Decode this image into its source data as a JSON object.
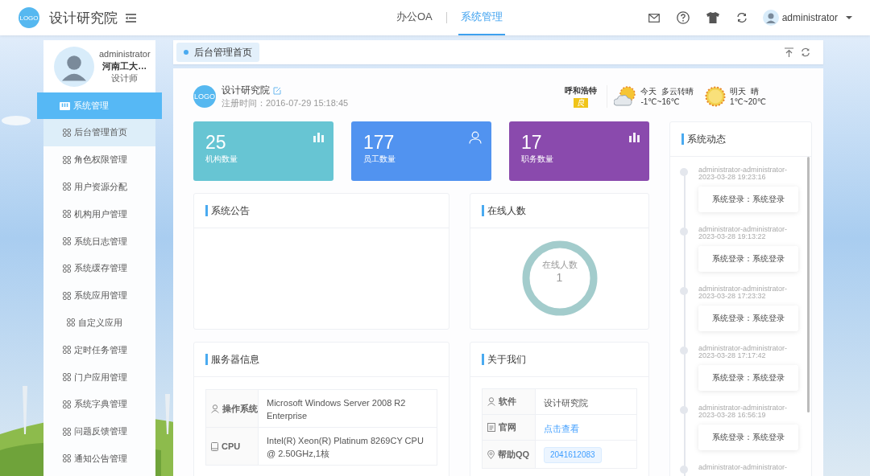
{
  "header": {
    "logo": "LOGO",
    "title": "设计研究院",
    "nav": [
      {
        "label": "办公OA",
        "selected": false
      },
      {
        "label": "系统管理",
        "selected": true
      }
    ],
    "user": "administrator"
  },
  "profile": {
    "name": "administrator",
    "org": "河南工大…",
    "role": "设计师"
  },
  "sidebar": {
    "section": "系统管理",
    "items": [
      {
        "label": "后台管理首页",
        "selected": true
      },
      {
        "label": "角色权限管理",
        "selected": false
      },
      {
        "label": "用户资源分配",
        "selected": false
      },
      {
        "label": "机构用户管理",
        "selected": false
      },
      {
        "label": "系统日志管理",
        "selected": false
      },
      {
        "label": "系统缓存管理",
        "selected": false
      },
      {
        "label": "系统应用管理",
        "selected": false
      },
      {
        "label": "自定义应用",
        "selected": false
      },
      {
        "label": "定时任务管理",
        "selected": false
      },
      {
        "label": "门户应用管理",
        "selected": false
      },
      {
        "label": "系统字典管理",
        "selected": false
      },
      {
        "label": "问题反馈管理",
        "selected": false
      },
      {
        "label": "通知公告管理",
        "selected": false
      }
    ]
  },
  "tab": {
    "label": "后台管理首页"
  },
  "org": {
    "logo": "LOGO",
    "name": "设计研究院",
    "registered": "注册时间：2016-07-29 15:18:45"
  },
  "weather": {
    "city": "呼和浩特",
    "aqi": "良",
    "days": [
      {
        "kind": "cloudy",
        "label": "今天  多云转晴",
        "temp": "-1℃~16℃"
      },
      {
        "kind": "sunny",
        "label": "明天  晴",
        "temp": "1℃~20℃"
      }
    ]
  },
  "stats": [
    {
      "value": "25",
      "label": "机构数量",
      "color": "#67c5d3",
      "kind": "chart"
    },
    {
      "value": "177",
      "label": "员工数量",
      "color": "#5193f0",
      "kind": "user"
    },
    {
      "value": "17",
      "label": "职务数量",
      "color": "#8a4aad",
      "kind": "chart"
    }
  ],
  "notice": {
    "title": "系统公告"
  },
  "online": {
    "title": "在线人数",
    "label": "在线人数",
    "count": "1"
  },
  "server": {
    "title": "服务器信息",
    "rows": [
      {
        "label": "操作系统",
        "value": "Microsoft Windows Server 2008 R2 Enterprise"
      },
      {
        "label": "CPU",
        "value": "Intel(R) Xeon(R) Platinum 8269CY CPU @ 2.50GHz,1核"
      }
    ]
  },
  "about": {
    "title": "关于我们",
    "rows": [
      {
        "label": "软件",
        "value": "设计研究院",
        "kind": "text"
      },
      {
        "label": "官网",
        "value": "点击查看",
        "kind": "link"
      },
      {
        "label": "帮助QQ",
        "value": "2041612083",
        "kind": "tag"
      }
    ]
  },
  "activity": {
    "title": "系统动态",
    "entries": [
      {
        "author": "administrator-administrator-",
        "time": "2023-03-28 19:23:16",
        "text": "系统登录：系统登录"
      },
      {
        "author": "administrator-administrator-",
        "time": "2023-03-28 19:13:22",
        "text": "系统登录：系统登录"
      },
      {
        "author": "administrator-administrator-",
        "time": "2023-03-28 17:23:32",
        "text": "系统登录：系统登录"
      },
      {
        "author": "administrator-administrator-",
        "time": "2023-03-28 17:17:42",
        "text": "系统登录：系统登录"
      },
      {
        "author": "administrator-administrator-",
        "time": "2023-03-28 16:56:19",
        "text": "系统登录：系统登录"
      },
      {
        "author": "administrator-administrator-"
      }
    ]
  }
}
